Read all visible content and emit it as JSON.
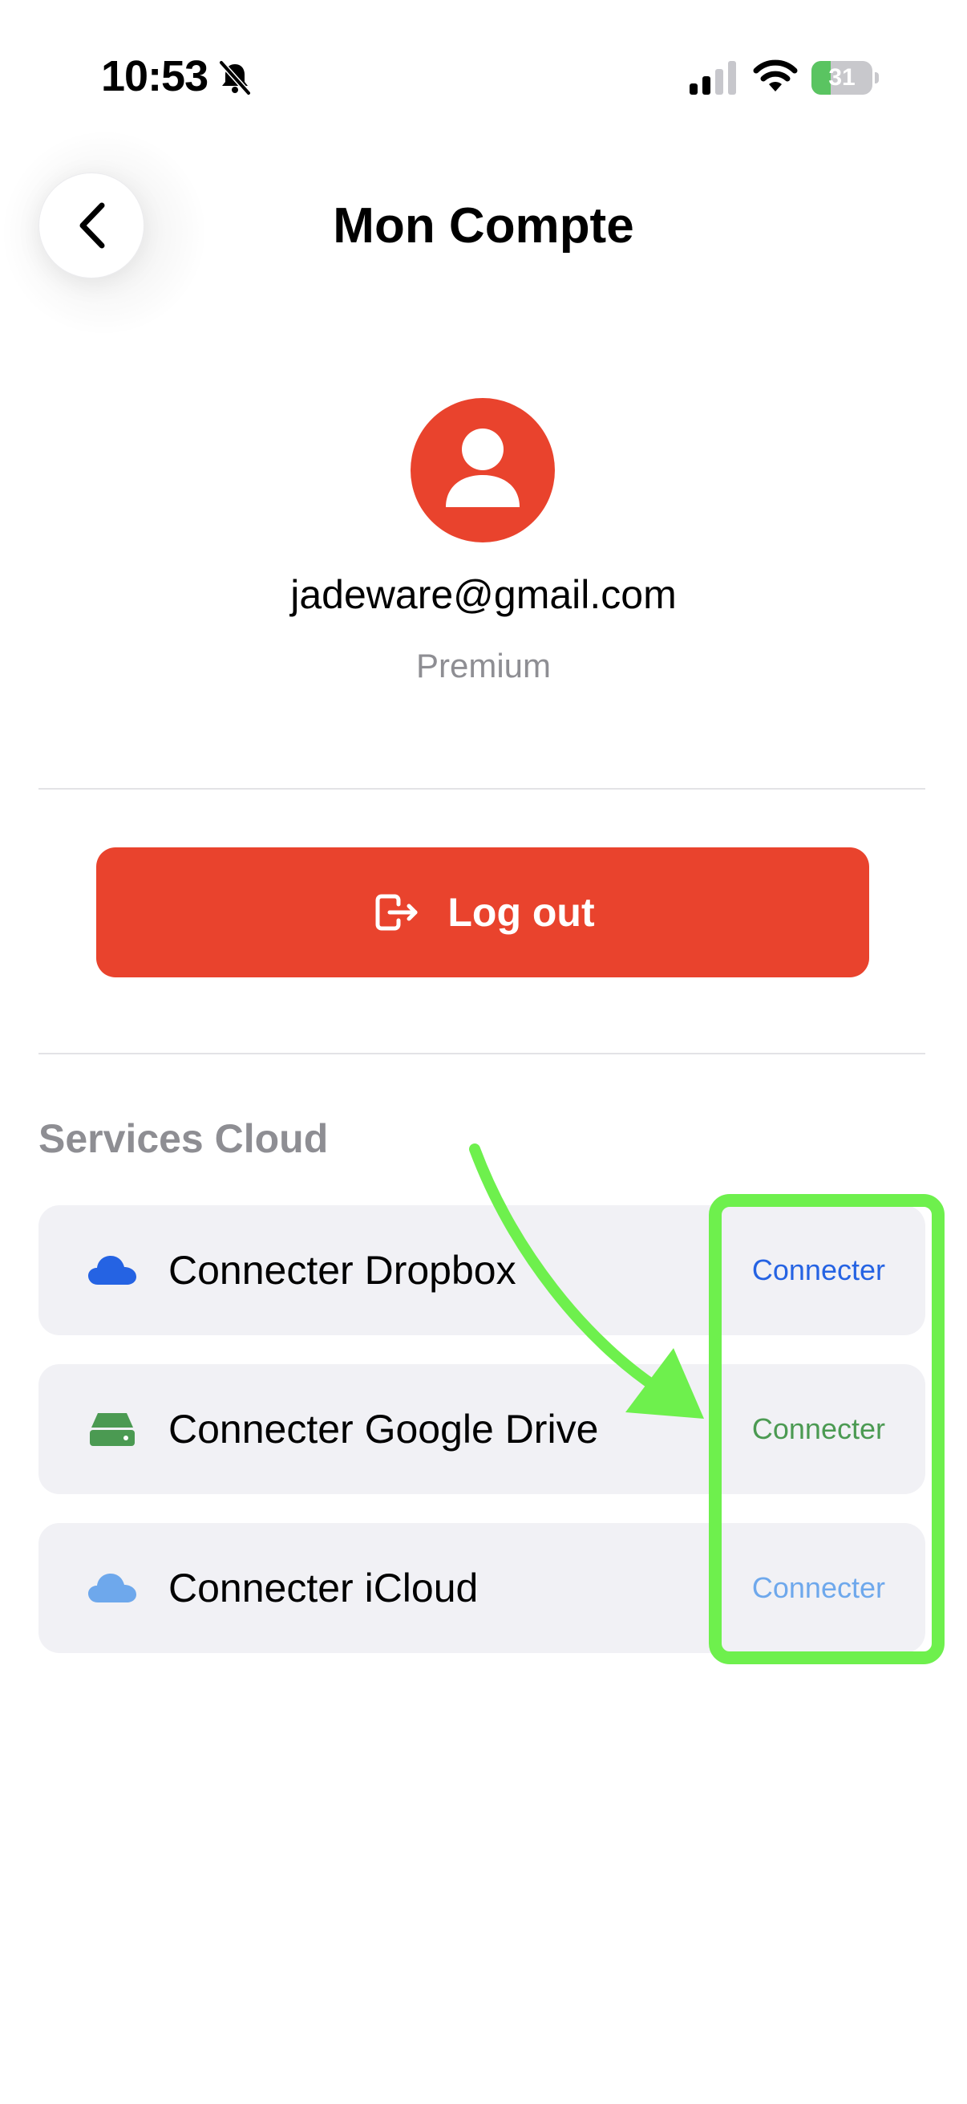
{
  "status_bar": {
    "time": "10:53",
    "battery_level": "31",
    "battery_fraction": 0.31,
    "icons": [
      "bell-slash-icon",
      "signal-icon",
      "wifi-icon",
      "battery-icon"
    ]
  },
  "header": {
    "title": "Mon Compte",
    "back_icon": "chevron-left-icon"
  },
  "profile": {
    "email": "jadeware@gmail.com",
    "plan": "Premium",
    "avatar_icon": "person-icon"
  },
  "logout": {
    "label": "Log out",
    "icon": "logout-icon"
  },
  "services": {
    "title": "Services Cloud",
    "items": [
      {
        "label": "Connecter Dropbox",
        "action": "Connecter",
        "icon": "cloud-icon",
        "color": "#2563e3"
      },
      {
        "label": "Connecter Google Drive",
        "action": "Connecter",
        "icon": "drive-icon",
        "color": "#4b9a52"
      },
      {
        "label": "Connecter iCloud",
        "action": "Connecter",
        "icon": "cloud-icon",
        "color": "#6ea8ec"
      }
    ]
  },
  "colors": {
    "accent_red": "#e9432d",
    "annotation_green": "#6ef04d",
    "muted_text": "#8e8e93",
    "row_background": "#f1f1f5"
  }
}
